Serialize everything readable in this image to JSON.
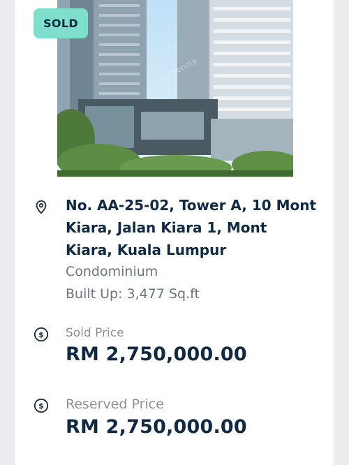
{
  "listing": {
    "status_badge": "SOLD",
    "photo": {
      "watermark": "auctionmy"
    },
    "address": "No. AA-25-02, Tower A, 10 Mont Kiara, Jalan Kiara 1, Mont Kiara, Kuala Lumpur",
    "property_type": "Condominium",
    "built_up": "Built Up: 3,477 Sq.ft",
    "sold_price": {
      "label": "Sold Price",
      "value": "RM 2,750,000.00"
    },
    "reserved_price": {
      "label": "Reserved Price",
      "value": "RM 2,750,000.00"
    }
  },
  "icons": {
    "location": "map-pin-icon",
    "price": "dollar-circle-icon"
  },
  "colors": {
    "badge_bg": "#7ee0cc",
    "heading_text": "#102a43",
    "muted_text": "#6b7480"
  }
}
